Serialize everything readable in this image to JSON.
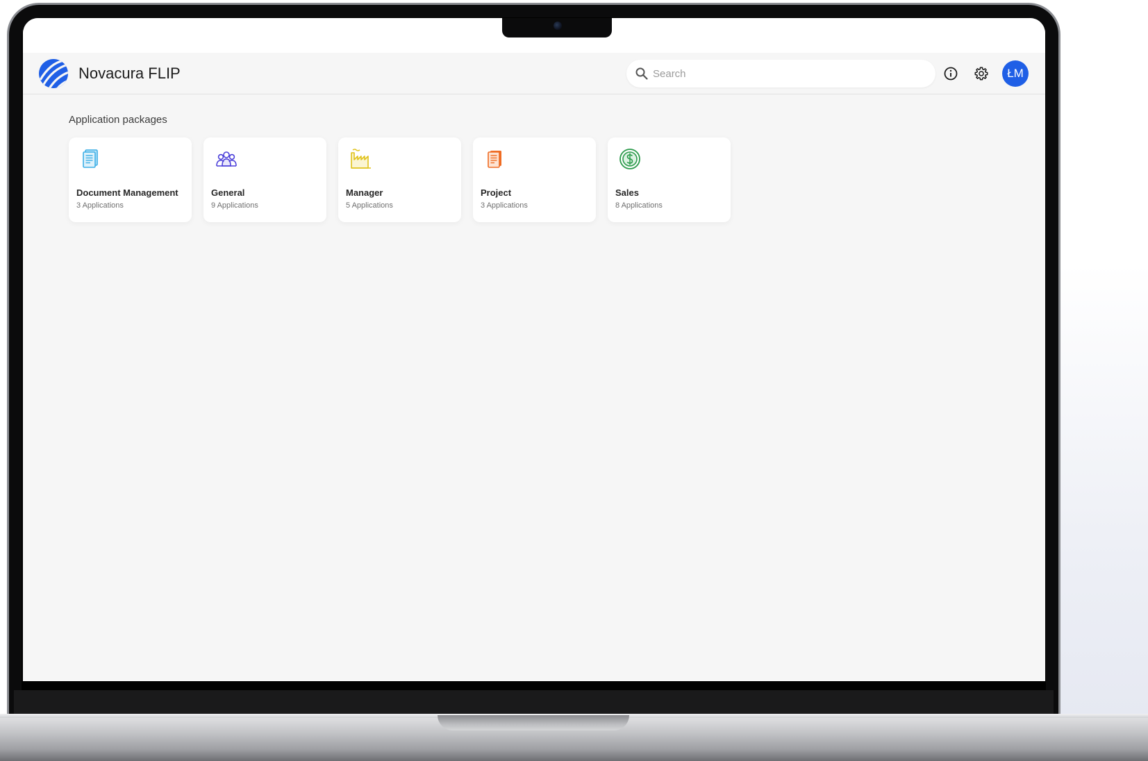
{
  "app": {
    "title": "Novacura FLIP"
  },
  "header": {
    "search_placeholder": "Search",
    "info_icon": "info-icon",
    "settings_icon": "gear-icon",
    "avatar_initials": "ŁM"
  },
  "section": {
    "title": "Application packages"
  },
  "packages": [
    {
      "name": "Document Management",
      "count": "3 Applications",
      "icon": "document-icon",
      "color": "#3aaee6"
    },
    {
      "name": "General",
      "count": "9 Applications",
      "icon": "users-group-icon",
      "color": "#4b3fd9"
    },
    {
      "name": "Manager",
      "count": "5 Applications",
      "icon": "factory-icon",
      "color": "#e0c21a"
    },
    {
      "name": "Project",
      "count": "3 Applications",
      "icon": "clipboard-icon",
      "color": "#ef6c24"
    },
    {
      "name": "Sales",
      "count": "8 Applications",
      "icon": "dollar-coin-icon",
      "color": "#2a9a4a"
    }
  ],
  "colors": {
    "accent": "#1f5fe6",
    "background": "#f6f6f6"
  }
}
